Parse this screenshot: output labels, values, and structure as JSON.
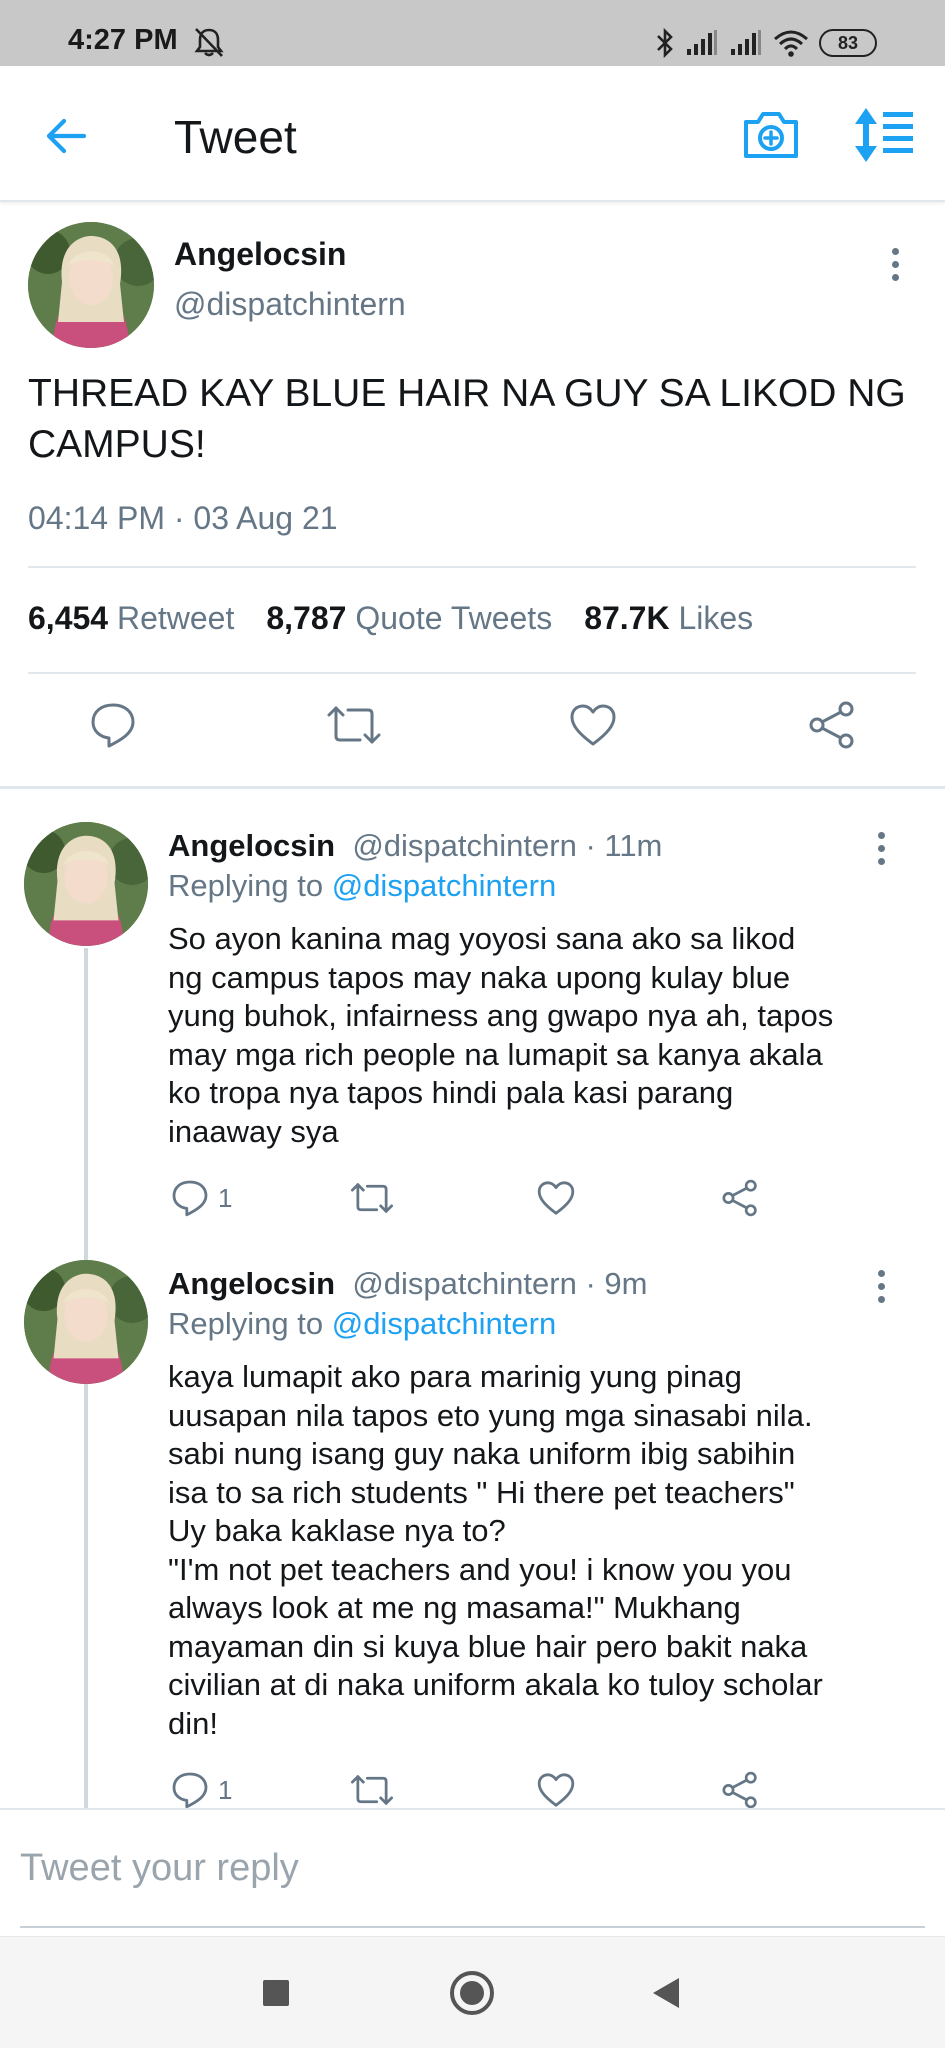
{
  "status_bar": {
    "time": "4:27 PM",
    "battery": "83",
    "icons": [
      "mute-icon",
      "bluetooth-icon",
      "signal-icon",
      "signal-icon",
      "wifi-icon",
      "battery-icon"
    ]
  },
  "header": {
    "title": "Tweet",
    "icons": [
      "back-arrow-icon",
      "camera-icon",
      "sort-icon"
    ]
  },
  "colors": {
    "accent": "#1da1f2",
    "text": "#14171a",
    "secondary": "#657786",
    "status_bar": "#c8c8c8"
  },
  "main_tweet": {
    "name": "Angelocsin",
    "handle": "@dispatchintern",
    "text": "THREAD KAY BLUE HAIR NA GUY SA LIKOD NG CAMPUS!",
    "timestamp": "04:14 PM · 03 Aug 21",
    "stats": {
      "retweets_count": "6,454",
      "retweets_label": "Retweet",
      "quotes_count": "8,787",
      "quotes_label": "Quote Tweets",
      "likes_count": "87.7K",
      "likes_label": "Likes"
    },
    "actions": [
      "reply-icon",
      "retweet-icon",
      "like-icon",
      "share-icon"
    ]
  },
  "replies": [
    {
      "name": "Angelocsin",
      "handle": "@dispatchintern",
      "time": "· 11m",
      "replying_label": "Replying to",
      "replying_to": "@dispatchintern",
      "text": "So ayon kanina mag yoyosi sana ako sa likod\nng campus tapos may naka upong kulay blue\nyung buhok, infairness ang gwapo nya ah, tapos\nmay mga rich people na lumapit sa kanya akala\nko tropa nya tapos hindi pala kasi parang\ninaaway sya",
      "reply_count": "1"
    },
    {
      "name": "Angelocsin",
      "handle": "@dispatchintern",
      "time": "· 9m",
      "replying_label": "Replying to",
      "replying_to": "@dispatchintern",
      "text": "kaya lumapit ako para marinig yung pinag\nuusapan nila tapos eto yung mga sinasabi nila.\n sabi nung isang guy naka uniform ibig sabihin\nisa to sa rich students \" Hi there pet teachers\"\nUy baka kaklase nya to?\n\"I'm not pet teachers and you! i know you you\nalways look at me ng masama!\" Mukhang\nmayaman din si kuya blue hair  pero bakit naka\ncivilian at di naka uniform akala ko tuloy scholar\ndin!",
      "reply_count": "1"
    }
  ],
  "reply_box": {
    "placeholder": "Tweet your reply"
  },
  "nav_bar": {
    "icons": [
      "recents-square-icon",
      "home-circle-icon",
      "back-triangle-icon"
    ]
  }
}
